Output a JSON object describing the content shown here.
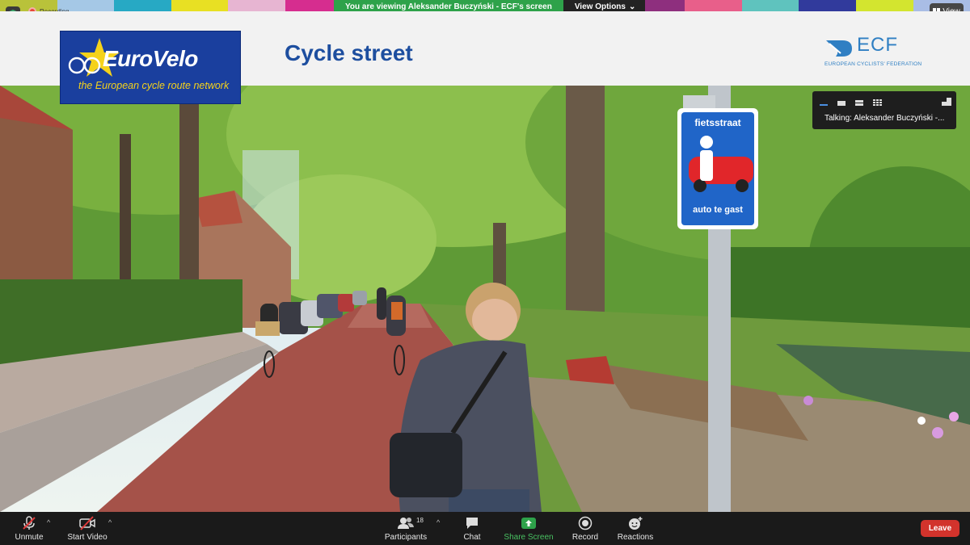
{
  "banner": {
    "message": "You are viewing Aleksander Buczyński - ECF's screen",
    "view_options": "View Options"
  },
  "recording_label": "Recording",
  "view_button": "View",
  "slide": {
    "eurovelo_name": "EuroVelo",
    "eurovelo_tagline": "the European cycle route network",
    "title": "Cycle street",
    "ecf_name": "ECF",
    "ecf_subtitle": "EUROPEAN CYCLISTS' FEDERATION",
    "sign_top": "fietsstraat",
    "sign_bottom": "auto te gast"
  },
  "speaker_panel": {
    "talking": "Talking: Aleksander Buczyński -..."
  },
  "toolbar": {
    "unmute": "Unmute",
    "start_video": "Start Video",
    "participants": "Participants",
    "participants_count": "18",
    "chat": "Chat",
    "share_screen": "Share Screen",
    "record": "Record",
    "reactions": "Reactions",
    "leave": "Leave"
  },
  "colors": {
    "strip": [
      "#b9c23a",
      "#a5c8e6",
      "#27a9c4",
      "#e8e023",
      "#e7b5d2",
      "#d62d8f",
      "#6fb53c",
      "#2b8ad1",
      "#e95c2f",
      "#3a7a3c",
      "#c8d65a",
      "#8e2f7e",
      "#e85f8a",
      "#5fc3be",
      "#313a9c",
      "#d3e52f",
      "#a9bde5"
    ],
    "slide_title": "#1d4e9f",
    "eurovelo_bg": "#1a3f9e",
    "share_green": "#2ea24a",
    "leave_red": "#d2332c"
  }
}
